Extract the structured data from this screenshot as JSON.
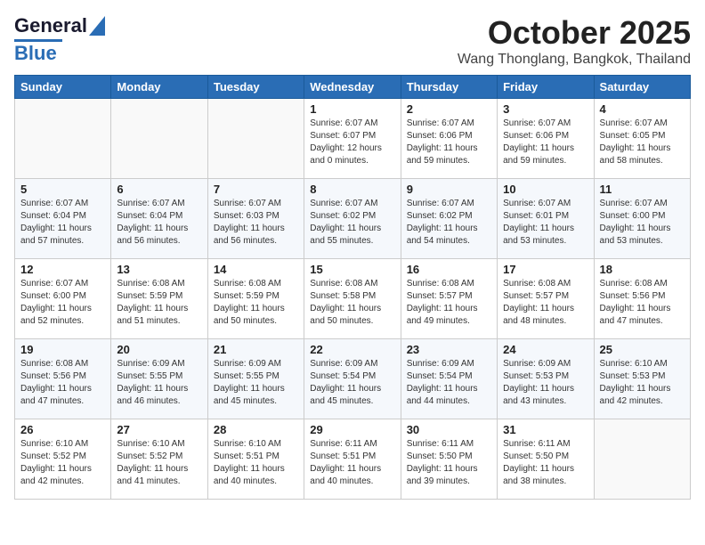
{
  "header": {
    "logo_general": "General",
    "logo_blue": "Blue",
    "month": "October 2025",
    "location": "Wang Thonglang, Bangkok, Thailand"
  },
  "weekdays": [
    "Sunday",
    "Monday",
    "Tuesday",
    "Wednesday",
    "Thursday",
    "Friday",
    "Saturday"
  ],
  "weeks": [
    [
      {
        "day": "",
        "info": ""
      },
      {
        "day": "",
        "info": ""
      },
      {
        "day": "",
        "info": ""
      },
      {
        "day": "1",
        "info": "Sunrise: 6:07 AM\nSunset: 6:07 PM\nDaylight: 12 hours\nand 0 minutes."
      },
      {
        "day": "2",
        "info": "Sunrise: 6:07 AM\nSunset: 6:06 PM\nDaylight: 11 hours\nand 59 minutes."
      },
      {
        "day": "3",
        "info": "Sunrise: 6:07 AM\nSunset: 6:06 PM\nDaylight: 11 hours\nand 59 minutes."
      },
      {
        "day": "4",
        "info": "Sunrise: 6:07 AM\nSunset: 6:05 PM\nDaylight: 11 hours\nand 58 minutes."
      }
    ],
    [
      {
        "day": "5",
        "info": "Sunrise: 6:07 AM\nSunset: 6:04 PM\nDaylight: 11 hours\nand 57 minutes."
      },
      {
        "day": "6",
        "info": "Sunrise: 6:07 AM\nSunset: 6:04 PM\nDaylight: 11 hours\nand 56 minutes."
      },
      {
        "day": "7",
        "info": "Sunrise: 6:07 AM\nSunset: 6:03 PM\nDaylight: 11 hours\nand 56 minutes."
      },
      {
        "day": "8",
        "info": "Sunrise: 6:07 AM\nSunset: 6:02 PM\nDaylight: 11 hours\nand 55 minutes."
      },
      {
        "day": "9",
        "info": "Sunrise: 6:07 AM\nSunset: 6:02 PM\nDaylight: 11 hours\nand 54 minutes."
      },
      {
        "day": "10",
        "info": "Sunrise: 6:07 AM\nSunset: 6:01 PM\nDaylight: 11 hours\nand 53 minutes."
      },
      {
        "day": "11",
        "info": "Sunrise: 6:07 AM\nSunset: 6:00 PM\nDaylight: 11 hours\nand 53 minutes."
      }
    ],
    [
      {
        "day": "12",
        "info": "Sunrise: 6:07 AM\nSunset: 6:00 PM\nDaylight: 11 hours\nand 52 minutes."
      },
      {
        "day": "13",
        "info": "Sunrise: 6:08 AM\nSunset: 5:59 PM\nDaylight: 11 hours\nand 51 minutes."
      },
      {
        "day": "14",
        "info": "Sunrise: 6:08 AM\nSunset: 5:59 PM\nDaylight: 11 hours\nand 50 minutes."
      },
      {
        "day": "15",
        "info": "Sunrise: 6:08 AM\nSunset: 5:58 PM\nDaylight: 11 hours\nand 50 minutes."
      },
      {
        "day": "16",
        "info": "Sunrise: 6:08 AM\nSunset: 5:57 PM\nDaylight: 11 hours\nand 49 minutes."
      },
      {
        "day": "17",
        "info": "Sunrise: 6:08 AM\nSunset: 5:57 PM\nDaylight: 11 hours\nand 48 minutes."
      },
      {
        "day": "18",
        "info": "Sunrise: 6:08 AM\nSunset: 5:56 PM\nDaylight: 11 hours\nand 47 minutes."
      }
    ],
    [
      {
        "day": "19",
        "info": "Sunrise: 6:08 AM\nSunset: 5:56 PM\nDaylight: 11 hours\nand 47 minutes."
      },
      {
        "day": "20",
        "info": "Sunrise: 6:09 AM\nSunset: 5:55 PM\nDaylight: 11 hours\nand 46 minutes."
      },
      {
        "day": "21",
        "info": "Sunrise: 6:09 AM\nSunset: 5:55 PM\nDaylight: 11 hours\nand 45 minutes."
      },
      {
        "day": "22",
        "info": "Sunrise: 6:09 AM\nSunset: 5:54 PM\nDaylight: 11 hours\nand 45 minutes."
      },
      {
        "day": "23",
        "info": "Sunrise: 6:09 AM\nSunset: 5:54 PM\nDaylight: 11 hours\nand 44 minutes."
      },
      {
        "day": "24",
        "info": "Sunrise: 6:09 AM\nSunset: 5:53 PM\nDaylight: 11 hours\nand 43 minutes."
      },
      {
        "day": "25",
        "info": "Sunrise: 6:10 AM\nSunset: 5:53 PM\nDaylight: 11 hours\nand 42 minutes."
      }
    ],
    [
      {
        "day": "26",
        "info": "Sunrise: 6:10 AM\nSunset: 5:52 PM\nDaylight: 11 hours\nand 42 minutes."
      },
      {
        "day": "27",
        "info": "Sunrise: 6:10 AM\nSunset: 5:52 PM\nDaylight: 11 hours\nand 41 minutes."
      },
      {
        "day": "28",
        "info": "Sunrise: 6:10 AM\nSunset: 5:51 PM\nDaylight: 11 hours\nand 40 minutes."
      },
      {
        "day": "29",
        "info": "Sunrise: 6:11 AM\nSunset: 5:51 PM\nDaylight: 11 hours\nand 40 minutes."
      },
      {
        "day": "30",
        "info": "Sunrise: 6:11 AM\nSunset: 5:50 PM\nDaylight: 11 hours\nand 39 minutes."
      },
      {
        "day": "31",
        "info": "Sunrise: 6:11 AM\nSunset: 5:50 PM\nDaylight: 11 hours\nand 38 minutes."
      },
      {
        "day": "",
        "info": ""
      }
    ]
  ]
}
